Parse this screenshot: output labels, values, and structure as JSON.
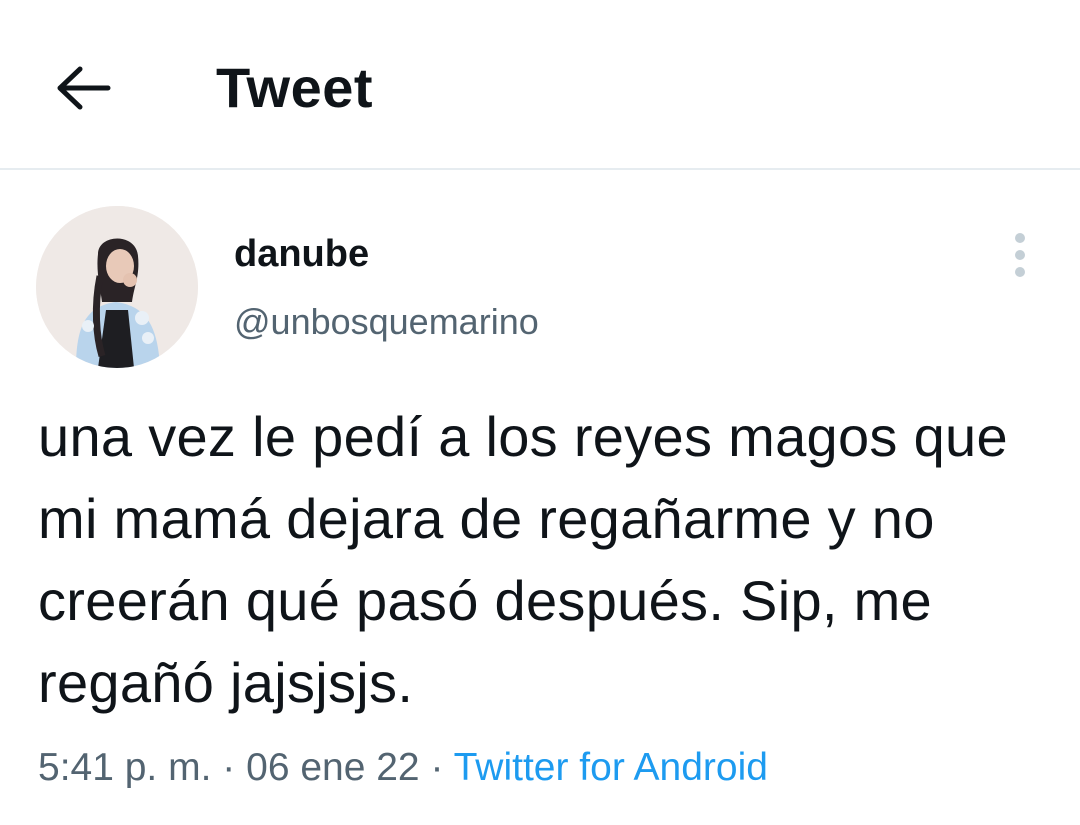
{
  "header": {
    "back_icon": "arrow-left-icon",
    "title": "Tweet"
  },
  "tweet": {
    "author": {
      "display_name": "danube",
      "handle": "@unbosquemarino",
      "avatar": "user-avatar-photo"
    },
    "more_icon": "vertical-ellipsis-icon",
    "text": "una vez le pedí a los reyes magos que mi mamá dejara de regañarme y no creerán qué pasó después. Sip, me regañó jajsjsjs.",
    "time": "5:41 p. m.",
    "separator": "·",
    "date": "06 ene 22",
    "source": "Twitter for Android"
  },
  "colors": {
    "text_primary": "#0f1419",
    "text_secondary": "#536471",
    "link": "#1d9bf0",
    "divider": "#e6ecf0"
  }
}
